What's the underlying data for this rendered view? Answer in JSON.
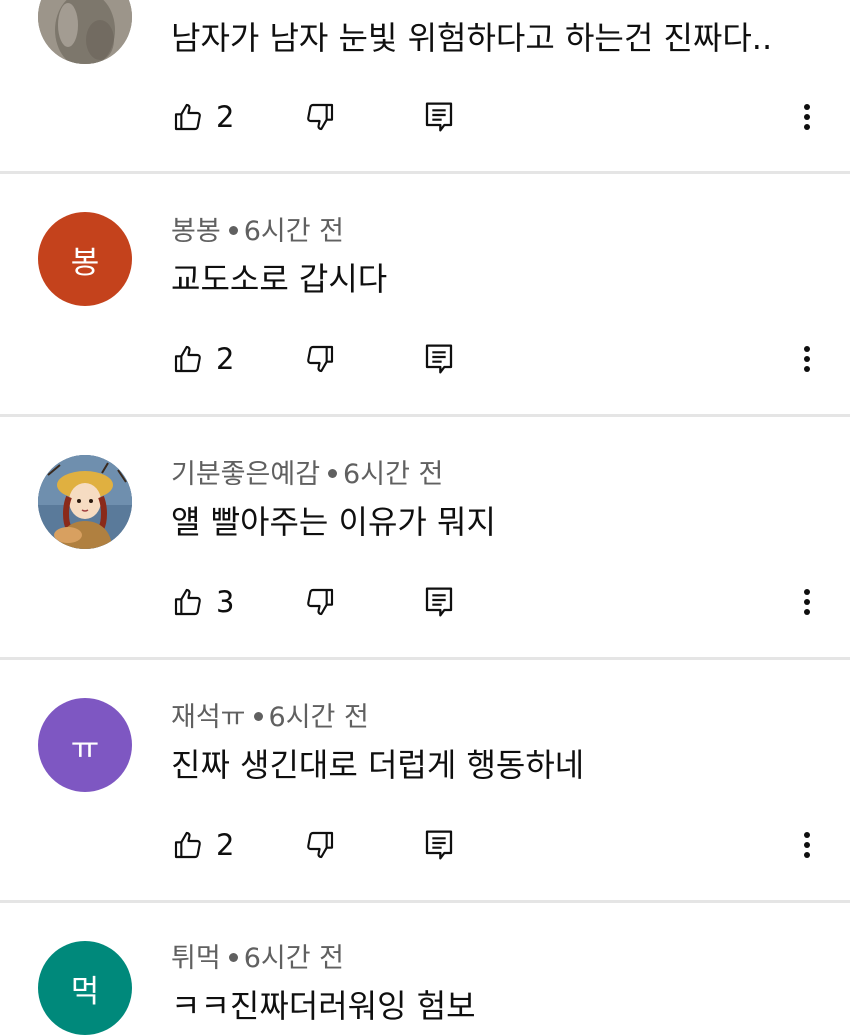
{
  "comments": [
    {
      "author": "",
      "time": "",
      "text": "남자가 남자 눈빛 위험하다고 하는건 진짜다..",
      "likes": "2",
      "avatar": {
        "type": "photo",
        "color": "#8a8478",
        "initial": ""
      }
    },
    {
      "author": "봉봉",
      "time": "6시간 전",
      "text": "교도소로 갑시다",
      "likes": "2",
      "avatar": {
        "type": "initial",
        "color": "#c4421c",
        "initial": "봉"
      }
    },
    {
      "author": "기분좋은예감",
      "time": "6시간 전",
      "text": "얠 빨아주는 이유가 뭐지",
      "likes": "3",
      "avatar": {
        "type": "illustration",
        "color": "#4a6a8c",
        "initial": ""
      }
    },
    {
      "author": "재석ㅠ",
      "time": "6시간 전",
      "text": "진짜 생긴대로 더럽게 행동하네",
      "likes": "2",
      "avatar": {
        "type": "initial",
        "color": "#7e57c2",
        "initial": "ㅠ"
      }
    },
    {
      "author": "튀먹",
      "time": "6시간 전",
      "text": "ㅋㅋ진짜더러워잉 험보",
      "likes": "",
      "avatar": {
        "type": "initial",
        "color": "#00897b",
        "initial": "먹"
      }
    }
  ],
  "icons": {
    "like": "thumbs-up-icon",
    "dislike": "thumbs-down-icon",
    "reply": "reply-icon",
    "more": "more-vertical-icon"
  }
}
